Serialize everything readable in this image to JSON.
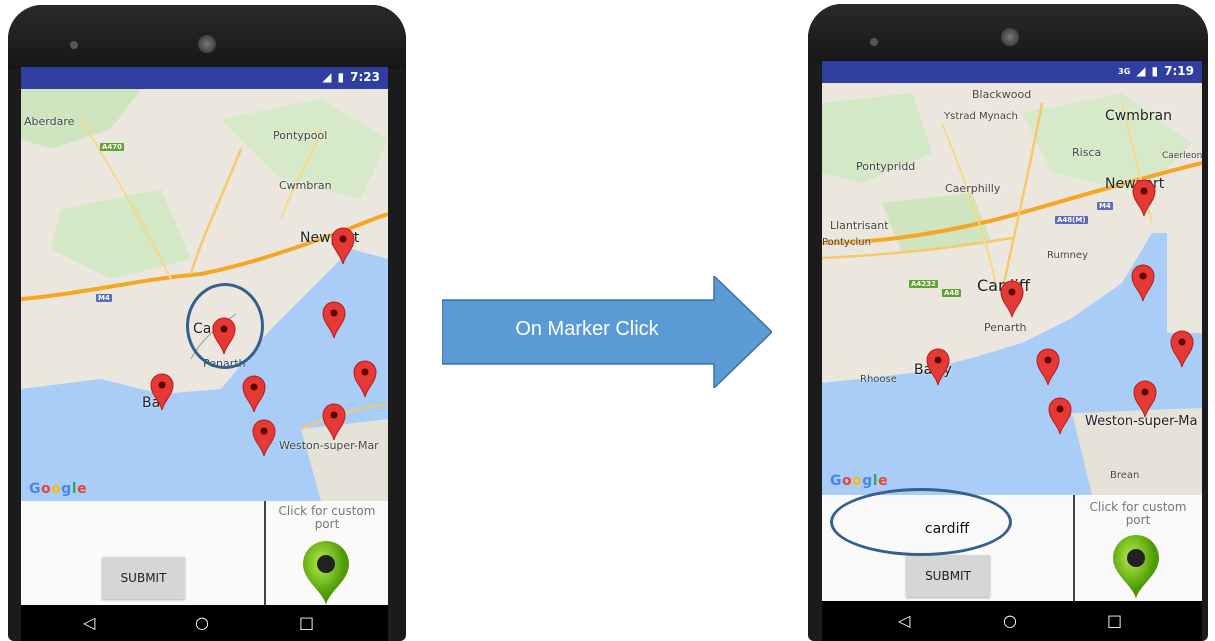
{
  "left_phone": {
    "status_time": "7:23",
    "places": [
      "Aberdare",
      "Pontypool",
      "Cwmbran",
      "Newport",
      "Car",
      "Penarth",
      "Bar",
      "Weston-super-Mar"
    ],
    "road_tags": [
      "A470",
      "M4"
    ],
    "google_logo": "Google",
    "custom_port_label": "Click for custom port",
    "submit_label": "SUBMIT",
    "input_value": ""
  },
  "right_phone": {
    "status_time": "7:19",
    "network": "3G",
    "places": [
      "Blackwood",
      "Ystrad Mynach",
      "Cwmbran",
      "Pontypridd",
      "Risca",
      "Caerleon",
      "Caerphilly",
      "Newport",
      "Llantrisant",
      "Pontyclun",
      "Rumney",
      "Cardiff",
      "Penarth",
      "Rhoose",
      "Barry",
      "Weston-super-Ma",
      "Brean"
    ],
    "road_tags": [
      "M4",
      "A48(M)",
      "A4232",
      "A48"
    ],
    "google_logo": "Google",
    "custom_port_label": "Click for custom port",
    "submit_label": "SUBMIT",
    "input_value": "cardiff"
  },
  "arrow_label": "On Marker Click",
  "colors": {
    "status_bar": "#303f9f",
    "annotation": "#34608f",
    "arrow_fill": "#5b9bd5",
    "marker": "#e53935",
    "custom_pin": "#7cc11f"
  },
  "nav_icons": [
    "back-icon",
    "home-icon",
    "recents-icon"
  ]
}
